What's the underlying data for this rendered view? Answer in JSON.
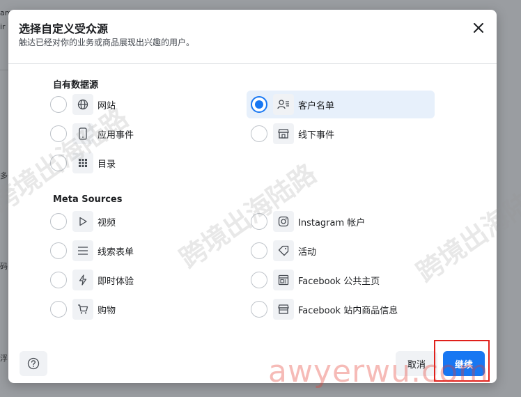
{
  "background_fragments": [
    "amp",
    "ir",
    "多去",
    "码",
    "浮"
  ],
  "dialog": {
    "title": "选择自定义受众源",
    "subtitle": "触达已经对你的业务或商品展现出兴趣的用户。"
  },
  "sections": {
    "own_sources": {
      "title": "自有数据源",
      "options": [
        {
          "label": "网站",
          "icon": "globe-icon",
          "selected": false
        },
        {
          "label": "客户名单",
          "icon": "contact-list-icon",
          "selected": true
        },
        {
          "label": "应用事件",
          "icon": "mobile-icon",
          "selected": false
        },
        {
          "label": "线下事件",
          "icon": "store-icon",
          "selected": false
        },
        {
          "label": "目录",
          "icon": "grid-icon",
          "selected": false
        }
      ]
    },
    "meta_sources": {
      "title": "Meta Sources",
      "options": [
        {
          "label": "视频",
          "icon": "play-icon",
          "selected": false
        },
        {
          "label": "Instagram 帐户",
          "icon": "instagram-icon",
          "selected": false
        },
        {
          "label": "线索表单",
          "icon": "list-icon",
          "selected": false
        },
        {
          "label": "活动",
          "icon": "tag-icon",
          "selected": false
        },
        {
          "label": "即时体验",
          "icon": "lightning-icon",
          "selected": false
        },
        {
          "label": "Facebook 公共主页",
          "icon": "page-icon",
          "selected": false
        },
        {
          "label": "购物",
          "icon": "cart-icon",
          "selected": false
        },
        {
          "label": "Facebook 站内商品信息",
          "icon": "shop-icon",
          "selected": false
        }
      ]
    }
  },
  "footer": {
    "help_icon": "help-icon",
    "cancel_label": "取消",
    "continue_label": "继续"
  },
  "watermarks": {
    "text": "跨境出海陆路",
    "url": "awyerwu.com"
  },
  "colors": {
    "accent": "#1877f2",
    "selected_bg": "#e7f0fb",
    "highlight_outline": "#e0201b"
  }
}
